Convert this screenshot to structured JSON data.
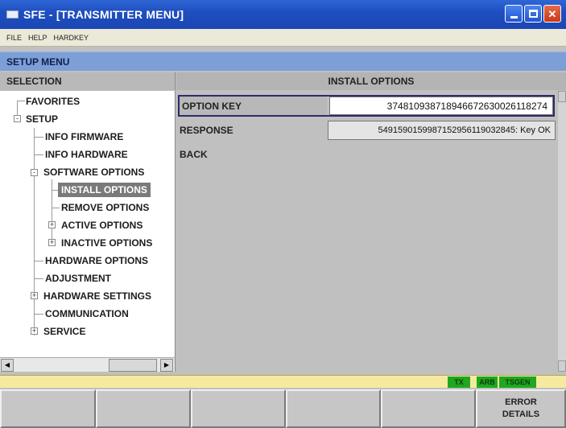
{
  "window": {
    "title": "SFE - [TRANSMITTER MENU]"
  },
  "menubar": {
    "items": [
      "FILE",
      "HELP",
      "HARDKEY"
    ]
  },
  "setup_menu": {
    "title": "SETUP MENU"
  },
  "columns": {
    "selection": "SELECTION",
    "install_options": "INSTALL OPTIONS"
  },
  "tree": {
    "items": [
      {
        "label": "FAVORITES",
        "level": 0
      },
      {
        "label": "SETUP",
        "level": 0,
        "expander": "-"
      },
      {
        "label": "INFO FIRMWARE",
        "level": 1
      },
      {
        "label": "INFO HARDWARE",
        "level": 1
      },
      {
        "label": "SOFTWARE OPTIONS",
        "level": 1,
        "expander": "-"
      },
      {
        "label": "INSTALL OPTIONS",
        "level": 2,
        "selected": true
      },
      {
        "label": "REMOVE OPTIONS",
        "level": 2
      },
      {
        "label": "ACTIVE OPTIONS",
        "level": 2,
        "expander": "+"
      },
      {
        "label": "INACTIVE OPTIONS",
        "level": 2,
        "expander": "+"
      },
      {
        "label": "HARDWARE OPTIONS",
        "level": 1
      },
      {
        "label": "ADJUSTMENT",
        "level": 1
      },
      {
        "label": "HARDWARE SETTINGS",
        "level": 1,
        "expander": "+"
      },
      {
        "label": "COMMUNICATION",
        "level": 1
      },
      {
        "label": "SERVICE",
        "level": 1,
        "expander": "+"
      }
    ]
  },
  "install_options": {
    "option_key_label": "OPTION KEY",
    "option_key_value": "374810938718946672630026118274",
    "response_label": "RESPONSE",
    "response_value": "549159015998715295611903284​5: Key OK",
    "back_label": "BACK"
  },
  "status": {
    "badges": [
      {
        "label": "TX",
        "color": "#1fa81f"
      },
      {
        "label": "ARB",
        "color": "#1fa81f"
      },
      {
        "label": "TSGEN",
        "color": "#1fa81f"
      }
    ]
  },
  "softkeys": [
    "",
    "",
    "",
    "",
    "",
    "ERROR\nDETAILS"
  ],
  "colors": {
    "titlebar": "#1f4fc0",
    "setup_header": "#7d9fd8",
    "status_strip": "#f6eaa0",
    "selected_item": "#7a7a7a"
  }
}
